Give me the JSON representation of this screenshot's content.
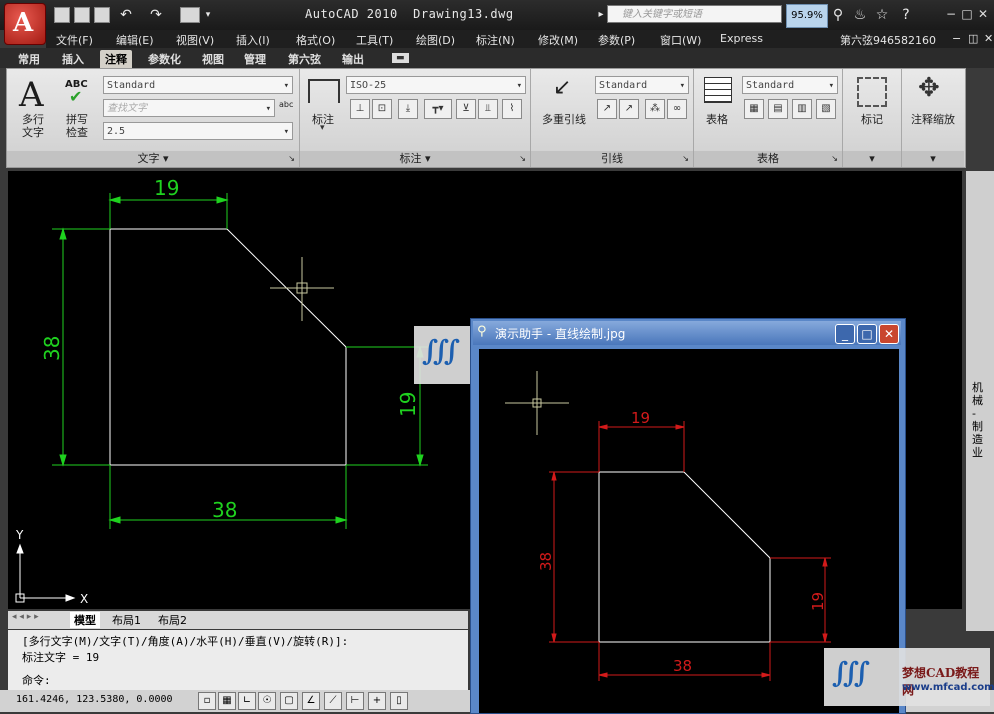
{
  "window": {
    "app_title": "AutoCAD 2010",
    "file_name": "Drawing13.dwg",
    "search_placeholder": "键入关键字或短语",
    "zoom_overlay": "95.9%",
    "user_label": "第六弦946582160"
  },
  "menu": [
    "文件(F)",
    "编辑(E)",
    "视图(V)",
    "插入(I)",
    "格式(O)",
    "工具(T)",
    "绘图(D)",
    "标注(N)",
    "修改(M)",
    "参数(P)",
    "窗口(W)",
    "Express"
  ],
  "ribbon_tabs": [
    "常用",
    "插入",
    "注释",
    "参数化",
    "视图",
    "管理",
    "第六弦",
    "输出"
  ],
  "active_tab": "注释",
  "ribbon": {
    "text_panel": {
      "label": "文字",
      "mtext_label_1": "多行",
      "mtext_label_2": "文字",
      "spell_icon": "ABC",
      "spell_label_1": "拼写",
      "spell_label_2": "检查",
      "style_value": "Standard",
      "find_placeholder": "查找文字",
      "height_value": "2.5"
    },
    "dim_panel": {
      "label": "标注",
      "button_label": "标注",
      "style_value": "ISO-25"
    },
    "leader_panel": {
      "label": "引线",
      "button_label": "多重引线",
      "style_value": "Standard"
    },
    "table_panel": {
      "label": "表格",
      "button_label": "表格",
      "style_value": "Standard"
    },
    "mark_panel": {
      "button_label": "标记"
    },
    "scale_panel": {
      "button_label": "注释缩放"
    }
  },
  "drawing": {
    "dim_top": "19",
    "dim_left": "38",
    "dim_right": "19",
    "dim_bottom": "38",
    "ucs_y": "Y",
    "ucs_x": "X"
  },
  "layout_tabs": [
    "模型",
    "布局1",
    "布局2"
  ],
  "command": {
    "line1": "[多行文字(M)/文字(T)/角度(A)/水平(H)/垂直(V)/旋转(R)]:",
    "line2": "标注文字 = 19",
    "prompt": "命令:"
  },
  "status": {
    "coords": "161.4246, 123.5380, 0.0000"
  },
  "right_strip": "机械 - 制造业",
  "popup": {
    "title": "演示助手 - 直线绘制.jpg",
    "dim_top": "19",
    "dim_left": "38",
    "dim_right": "19",
    "dim_bottom": "38"
  },
  "watermark": {
    "brand": "梦想CAD教程网",
    "url": "www.mfcad.com"
  },
  "colors": {
    "drawing_bg": "#000000",
    "dim_green": "#1fd21f",
    "geometry_white": "#ffffff",
    "popup_dim_red": "#d21a1a",
    "popup_frame_blue": "#5a87c8"
  }
}
